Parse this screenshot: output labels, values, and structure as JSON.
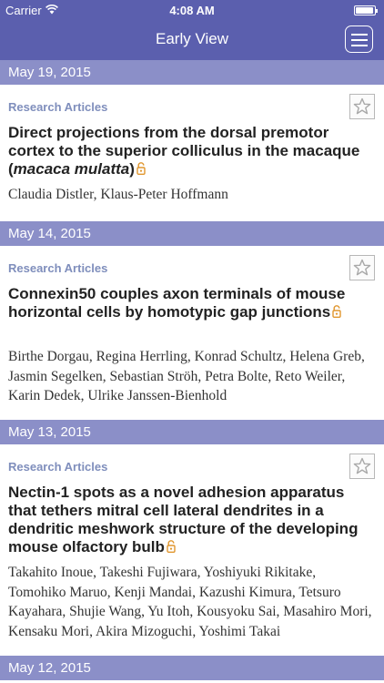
{
  "status_bar": {
    "carrier": "Carrier",
    "time": "4:08 AM"
  },
  "nav": {
    "title": "Early View"
  },
  "icons": {
    "wifi": "wifi-icon",
    "battery": "battery-icon",
    "menu": "hamburger-menu-icon",
    "star": "star-icon",
    "lock": "open-access-lock-icon"
  },
  "colors": {
    "nav_bg": "#5b5fae",
    "date_header_bg": "#8b8fc8",
    "section_label": "#7f8ebc",
    "lock": "#e0962e"
  },
  "groups": [
    {
      "date": "May 19, 2015",
      "article": {
        "section": "Research Articles",
        "title_before": "Direct projections from the dorsal premotor cortex to the superior colliculus in the macaque (",
        "title_italic": "macaca mulatta",
        "title_after": ")",
        "authors": "Claudia Distler, Klaus-Peter Hoffmann"
      }
    },
    {
      "date": "May 14, 2015",
      "article": {
        "section": "Research Articles",
        "title": "Connexin50 couples axon terminals of mouse horizontal cells by homotypic gap junctions",
        "authors": "Birthe Dorgau, Regina Herrling, Konrad Schultz, Helena Greb, Jasmin Segelken, Sebastian Ströh, Petra Bolte, Reto Weiler, Karin Dedek, Ulrike Janssen-Bienhold"
      }
    },
    {
      "date": "May 13, 2015",
      "article": {
        "section": "Research Articles",
        "title": "Nectin-1 spots as a novel adhesion apparatus that tethers mitral cell lateral dendrites in a dendritic meshwork structure of the developing mouse olfactory bulb",
        "authors": "Takahito Inoue, Takeshi Fujiwara, Yoshiyuki Rikitake, Tomohiko Maruo, Kenji Mandai, Kazushi Kimura, Tetsuro Kayahara, Shujie Wang, Yu Itoh, Kousyoku Sai, Masahiro Mori, Kensaku Mori, Akira Mizoguchi, Yoshimi Takai"
      }
    },
    {
      "date": "May 12, 2015"
    }
  ]
}
